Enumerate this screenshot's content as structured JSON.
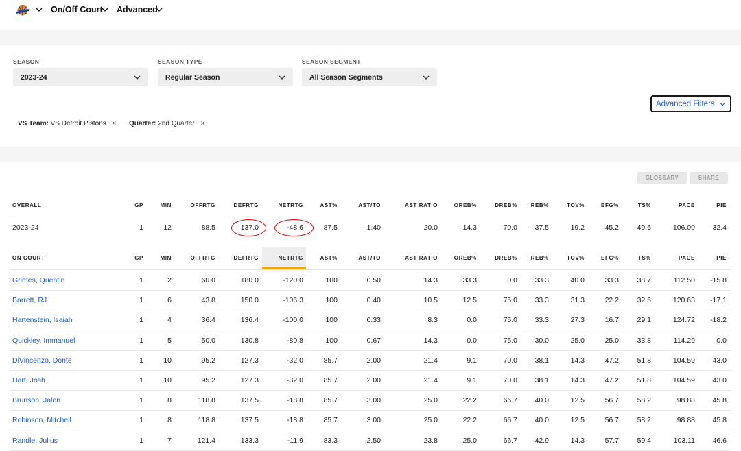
{
  "header": {
    "team_logo": "knicks-logo",
    "view_label": "On/Off Court",
    "mode_label": "Advanced"
  },
  "filters": {
    "season": {
      "label": "SEASON",
      "value": "2023-24"
    },
    "season_type": {
      "label": "SEASON TYPE",
      "value": "Regular Season"
    },
    "season_segment": {
      "label": "SEASON SEGMENT",
      "value": "All Season Segments"
    },
    "advanced_filters_label": "Advanced Filters",
    "chips": [
      {
        "key": "VS Team:",
        "value": "VS Detroit Pistons"
      },
      {
        "key": "Quarter:",
        "value": "2nd Quarter"
      }
    ],
    "chip_close": "×"
  },
  "actions": {
    "glossary": "GLOSSARY",
    "share": "SHARE"
  },
  "overall": {
    "headers": [
      "OVERALL",
      "GP",
      "MIN",
      "OFFRTG",
      "DEFRTG",
      "NETRTG",
      "AST%",
      "AST/TO",
      "AST RATIO",
      "OREB%",
      "DREB%",
      "REB%",
      "TOV%",
      "EFG%",
      "TS%",
      "PACE",
      "PIE"
    ],
    "row": [
      "2023-24",
      "1",
      "12",
      "88.5",
      "137.0",
      "-48.6",
      "87.5",
      "1.40",
      "20.0",
      "14.3",
      "70.0",
      "37.5",
      "19.2",
      "45.2",
      "49.6",
      "106.00",
      "32.4"
    ]
  },
  "on_court": {
    "headers": [
      "ON COURT",
      "GP",
      "MIN",
      "OFFRTG",
      "DEFRTG",
      "NETRTG",
      "AST%",
      "AST/TO",
      "AST RATIO",
      "OREB%",
      "DREB%",
      "REB%",
      "TOV%",
      "EFG%",
      "TS%",
      "PACE",
      "PIE"
    ],
    "sorted_column": "NETRTG",
    "rows": [
      [
        "Grimes, Quentin",
        "1",
        "2",
        "60.0",
        "180.0",
        "-120.0",
        "100",
        "0.50",
        "14.3",
        "33.3",
        "0.0",
        "33.3",
        "40.0",
        "33.3",
        "38.7",
        "112.50",
        "-15.8"
      ],
      [
        "Barrett, RJ",
        "1",
        "6",
        "43.8",
        "150.0",
        "-106.3",
        "100",
        "0.40",
        "10.5",
        "12.5",
        "75.0",
        "33.3",
        "31.3",
        "22.2",
        "32.5",
        "120.63",
        "-17.1"
      ],
      [
        "Hartenstein, Isaiah",
        "1",
        "4",
        "36.4",
        "136.4",
        "-100.0",
        "100",
        "0.33",
        "8.3",
        "0.0",
        "75.0",
        "33.3",
        "27.3",
        "16.7",
        "29.1",
        "124.72",
        "-18.2"
      ],
      [
        "Quickley, Immanuel",
        "1",
        "5",
        "50.0",
        "130.8",
        "-80.8",
        "100",
        "0.67",
        "14.3",
        "0.0",
        "75.0",
        "30.0",
        "25.0",
        "25.0",
        "33.8",
        "114.29",
        "0.0"
      ],
      [
        "DiVincenzo, Donte",
        "1",
        "10",
        "95.2",
        "127.3",
        "-32.0",
        "85.7",
        "2.00",
        "21.4",
        "9.1",
        "70.0",
        "38.1",
        "14.3",
        "47.2",
        "51.8",
        "104.59",
        "43.0"
      ],
      [
        "Hart, Josh",
        "1",
        "10",
        "95.2",
        "127.3",
        "-32.0",
        "85.7",
        "2.00",
        "21.4",
        "9.1",
        "70.0",
        "38.1",
        "14.3",
        "47.2",
        "51.8",
        "104.59",
        "43.0"
      ],
      [
        "Brunson, Jalen",
        "1",
        "8",
        "118.8",
        "137.5",
        "-18.8",
        "85.7",
        "3.00",
        "25.0",
        "22.2",
        "66.7",
        "40.0",
        "12.5",
        "56.7",
        "58.2",
        "98.88",
        "45.8"
      ],
      [
        "Robinson, Mitchell",
        "1",
        "8",
        "118.8",
        "137.5",
        "-18.8",
        "85.7",
        "3.00",
        "25.0",
        "22.2",
        "66.7",
        "40.0",
        "12.5",
        "56.7",
        "58.2",
        "98.88",
        "45.8"
      ],
      [
        "Randle, Julius",
        "1",
        "7",
        "121.4",
        "133.3",
        "-11.9",
        "83.3",
        "2.50",
        "23.8",
        "25.0",
        "66.7",
        "42.9",
        "14.3",
        "57.7",
        "59.4",
        "103.11",
        "46.6"
      ]
    ]
  },
  "annotations": {
    "circle_color": "#dd0000"
  },
  "colors": {
    "link": "#1d5ed8",
    "sort_accent": "#f0a500"
  }
}
